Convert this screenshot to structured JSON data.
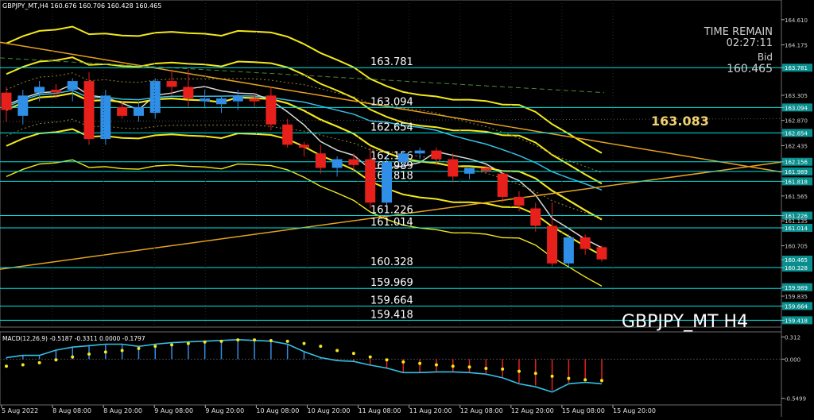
{
  "chart_header": "GBPJPY_MT,H4  160.676 160.706 160.428 160.465",
  "time_remain_label": "TIME REMAIN",
  "time_remain_value": "02:27:11",
  "bid_label": "Bid",
  "bid_value": "160.465",
  "highlight_value": "163.083",
  "symbol_watermark": "GBPJPY_MT H4",
  "macd_header": "MACD(12,26,9) -0.5187 -0.3311 0.0000 -0.1797",
  "colors": {
    "background": "#000000",
    "bull_candle": "#2f8ee6",
    "bear_candle": "#e8201c",
    "level_line": "#00e5e5",
    "band_yellow": "#f3e81a",
    "trend_orange": "#e6a21f",
    "ma_white": "#d9d9d9",
    "cyan_ma": "#35c0e6",
    "macd_signal": "#f3e81a",
    "grid": "#6b6b6b"
  },
  "chart_data": {
    "type": "candlestick",
    "symbol": "GBPJPY_MT",
    "timeframe": "H4",
    "price_ylim": [
      159.3,
      164.95
    ],
    "price_ticks": [
      "164.610",
      "164.175",
      "163.781",
      "163.305",
      "163.094",
      "162.870",
      "162.654",
      "162.435",
      "162.156",
      "161.989",
      "161.818",
      "161.565",
      "161.226",
      "161.135",
      "161.014",
      "160.705",
      "160.465",
      "160.328",
      "159.989",
      "159.835",
      "159.664",
      "159.418"
    ],
    "price_tick_highlighted": [
      "163.781",
      "163.094",
      "162.654",
      "162.156",
      "161.989",
      "161.818",
      "161.226",
      "161.014",
      "160.465",
      "160.328",
      "159.989",
      "159.664",
      "159.418"
    ],
    "levels": [
      {
        "label": "163.781",
        "value": 163.781
      },
      {
        "label": "163.094",
        "value": 163.094
      },
      {
        "label": "162.654",
        "value": 162.654
      },
      {
        "label": "162.156",
        "value": 162.156
      },
      {
        "label": "161.989",
        "value": 161.989
      },
      {
        "label": "161.818",
        "value": 161.818
      },
      {
        "label": "161.226",
        "value": 161.226
      },
      {
        "label": "161.014",
        "value": 161.014
      },
      {
        "label": "160.328",
        "value": 160.328
      },
      {
        "label": "159.969",
        "value": 159.969
      },
      {
        "label": "159.664",
        "value": 159.664
      },
      {
        "label": "159.418",
        "value": 159.418
      }
    ],
    "x_labels": [
      "5 Aug 2022",
      "8 Aug 08:00",
      "8 Aug 20:00",
      "9 Aug 08:00",
      "9 Aug 20:00",
      "10 Aug 08:00",
      "10 Aug 20:00",
      "11 Aug 08:00",
      "11 Aug 20:00",
      "12 Aug 08:00",
      "12 Aug 20:00",
      "15 Aug 08:00",
      "15 Aug 20:00"
    ],
    "candles": [
      {
        "o": 163.35,
        "h": 163.45,
        "c": 163.05,
        "l": 162.85
      },
      {
        "o": 162.95,
        "h": 163.4,
        "c": 163.3,
        "l": 162.8
      },
      {
        "o": 163.35,
        "h": 163.55,
        "c": 163.45,
        "l": 163.2
      },
      {
        "o": 163.4,
        "h": 163.5,
        "c": 163.35,
        "l": 163.25
      },
      {
        "o": 163.4,
        "h": 163.6,
        "c": 163.55,
        "l": 163.2
      },
      {
        "o": 163.55,
        "h": 163.7,
        "c": 162.55,
        "l": 162.45
      },
      {
        "o": 162.55,
        "h": 163.4,
        "c": 163.3,
        "l": 162.45
      },
      {
        "o": 163.1,
        "h": 163.2,
        "c": 162.95,
        "l": 162.9
      },
      {
        "o": 162.95,
        "h": 163.2,
        "c": 163.1,
        "l": 162.85
      },
      {
        "o": 163.0,
        "h": 163.6,
        "c": 163.55,
        "l": 162.9
      },
      {
        "o": 163.55,
        "h": 163.75,
        "c": 163.45,
        "l": 163.3
      },
      {
        "o": 163.45,
        "h": 163.75,
        "c": 163.25,
        "l": 163.1
      },
      {
        "o": 163.2,
        "h": 163.4,
        "c": 163.25,
        "l": 163.1
      },
      {
        "o": 163.15,
        "h": 163.3,
        "c": 163.25,
        "l": 163.0
      },
      {
        "o": 163.2,
        "h": 163.4,
        "c": 163.3,
        "l": 163.05
      },
      {
        "o": 163.25,
        "h": 163.35,
        "c": 163.2,
        "l": 163.1
      },
      {
        "o": 163.3,
        "h": 163.45,
        "c": 162.8,
        "l": 162.7
      },
      {
        "o": 162.8,
        "h": 162.9,
        "c": 162.45,
        "l": 162.4
      },
      {
        "o": 162.45,
        "h": 162.5,
        "c": 162.4,
        "l": 162.25
      },
      {
        "o": 162.3,
        "h": 162.45,
        "c": 162.05,
        "l": 161.95
      },
      {
        "o": 162.05,
        "h": 162.25,
        "c": 162.2,
        "l": 161.9
      },
      {
        "o": 162.2,
        "h": 162.3,
        "c": 162.1,
        "l": 162.0
      },
      {
        "o": 162.2,
        "h": 162.4,
        "c": 161.45,
        "l": 161.35
      },
      {
        "o": 161.45,
        "h": 162.25,
        "c": 162.15,
        "l": 161.4
      },
      {
        "o": 162.15,
        "h": 162.35,
        "c": 162.3,
        "l": 162.05
      },
      {
        "o": 162.3,
        "h": 162.4,
        "c": 162.35,
        "l": 162.2
      },
      {
        "o": 162.35,
        "h": 162.4,
        "c": 162.2,
        "l": 162.1
      },
      {
        "o": 162.2,
        "h": 162.3,
        "c": 161.9,
        "l": 161.8
      },
      {
        "o": 161.95,
        "h": 162.05,
        "c": 162.05,
        "l": 161.85
      },
      {
        "o": 162.05,
        "h": 162.1,
        "c": 162.0,
        "l": 161.95
      },
      {
        "o": 161.95,
        "h": 162.0,
        "c": 161.55,
        "l": 161.45
      },
      {
        "o": 161.55,
        "h": 161.65,
        "c": 161.4,
        "l": 161.3
      },
      {
        "o": 161.35,
        "h": 161.45,
        "c": 161.05,
        "l": 160.95
      },
      {
        "o": 161.05,
        "h": 161.45,
        "c": 160.4,
        "l": 160.35
      },
      {
        "o": 160.4,
        "h": 160.9,
        "c": 160.85,
        "l": 160.35
      },
      {
        "o": 160.85,
        "h": 160.9,
        "c": 160.65,
        "l": 160.55
      },
      {
        "o": 160.68,
        "h": 160.71,
        "c": 160.47,
        "l": 160.43
      }
    ],
    "macd": {
      "label": "MACD(12,26,9)",
      "ylim": [
        -0.62,
        0.36
      ],
      "ticks": [
        "0.312",
        "0.000",
        "-0.5499"
      ],
      "histogram": [
        0.02,
        0.05,
        0.05,
        0.12,
        0.16,
        0.18,
        0.2,
        0.2,
        0.17,
        0.2,
        0.22,
        0.23,
        0.24,
        0.25,
        0.26,
        0.25,
        0.24,
        0.2,
        0.1,
        0.02,
        -0.02,
        -0.03,
        -0.08,
        -0.12,
        -0.18,
        -0.18,
        -0.17,
        -0.17,
        -0.18,
        -0.2,
        -0.25,
        -0.33,
        -0.37,
        -0.44,
        -0.33,
        -0.31,
        -0.33
      ],
      "signal": [
        -0.1,
        -0.08,
        -0.05,
        -0.01,
        0.03,
        0.07,
        0.1,
        0.12,
        0.15,
        0.18,
        0.2,
        0.22,
        0.24,
        0.25,
        0.27,
        0.27,
        0.26,
        0.25,
        0.22,
        0.18,
        0.12,
        0.08,
        0.03,
        -0.01,
        -0.04,
        -0.06,
        -0.08,
        -0.1,
        -0.11,
        -0.13,
        -0.14,
        -0.17,
        -0.2,
        -0.24,
        -0.27,
        -0.29,
        -0.3
      ]
    }
  }
}
